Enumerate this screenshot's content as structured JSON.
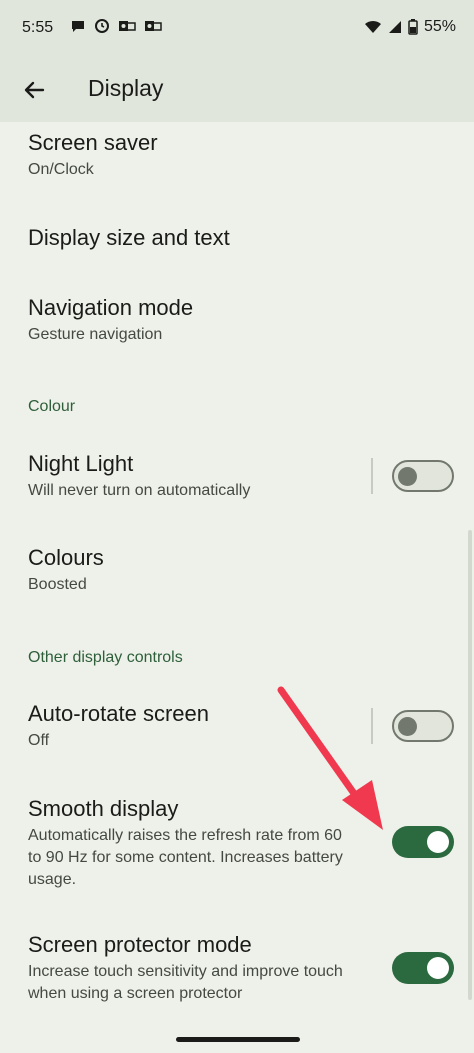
{
  "status_bar": {
    "time": "5:55",
    "battery": "55%",
    "left_icons": [
      "chat-icon",
      "clock-alert-icon",
      "outlook-icon",
      "outlook-icon"
    ],
    "right_icons": [
      "wifi-icon",
      "signal-icon",
      "battery-icon"
    ]
  },
  "app_bar": {
    "title": "Display"
  },
  "items": {
    "screen_saver": {
      "title": "Screen saver",
      "subtitle": "On/Clock"
    },
    "display_size": {
      "title": "Display size and text"
    },
    "navigation_mode": {
      "title": "Navigation mode",
      "subtitle": "Gesture navigation"
    },
    "night_light": {
      "title": "Night Light",
      "subtitle": "Will never turn on automatically",
      "enabled": false
    },
    "colours": {
      "title": "Colours",
      "subtitle": "Boosted"
    },
    "auto_rotate": {
      "title": "Auto-rotate screen",
      "subtitle": "Off",
      "enabled": false
    },
    "smooth_display": {
      "title": "Smooth display",
      "subtitle_line1": "Automatically raises the refresh rate from 60",
      "subtitle_line2": "to 90 Hz for some content. Increases battery",
      "subtitle_line3": "usage.",
      "enabled": true
    },
    "screen_protector": {
      "title": "Screen protector mode",
      "subtitle_line1": "Increase touch sensitivity and improve touch",
      "subtitle_line2": "when using a screen protector",
      "enabled": true
    }
  },
  "sections": {
    "colour": "Colour",
    "other": "Other display controls"
  },
  "colors": {
    "background": "#eef1ea",
    "accent": "#2b6a3e",
    "section_header": "#2e5f3a",
    "annotation_arrow": "#f0394f"
  }
}
